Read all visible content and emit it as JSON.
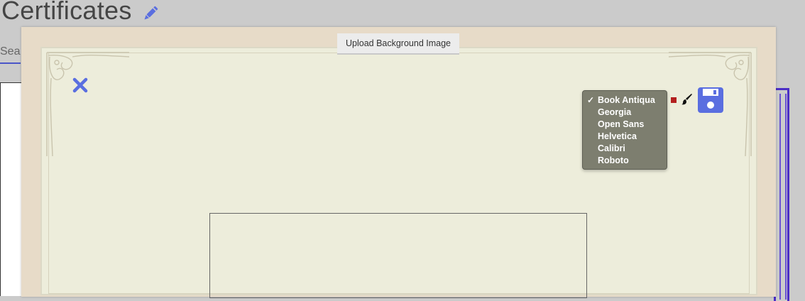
{
  "page": {
    "title": "Certificates",
    "search_tab_label": "Sea"
  },
  "editor": {
    "upload_button_label": "Upload Background Image",
    "font_options": [
      "Book Antiqua",
      "Georgia",
      "Open Sans",
      "Helvetica",
      "Calibri",
      "Roboto"
    ],
    "selected_font": "Book Antiqua",
    "checkmark": "✓",
    "text_color": "#b3201f"
  },
  "colors": {
    "accent": "#5a6ee0",
    "modal_background": "#e7dbc8",
    "certificate_background": "#ededdb",
    "dropdown_background": "#7d7e6f"
  },
  "icons": [
    "edit-icon",
    "close-icon",
    "brush-icon",
    "save-icon"
  ]
}
